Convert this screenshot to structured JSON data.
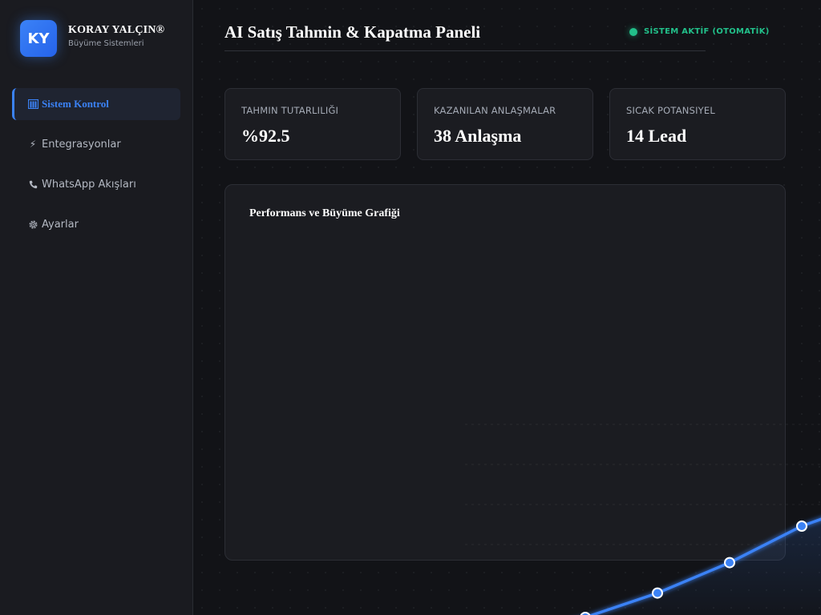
{
  "brand": {
    "logo": "KY",
    "name": "KORAY YALÇIN®",
    "subtitle": "Büyüme Sistemleri"
  },
  "sidebar": {
    "items": [
      {
        "icon": "building-icon",
        "label": "Sistem Kontrol",
        "active": true
      },
      {
        "icon": "lightning-icon",
        "label": "Entegrasyonlar",
        "active": false
      },
      {
        "icon": "phone-icon",
        "label": "WhatsApp Akışları",
        "active": false
      },
      {
        "icon": "gear-icon",
        "label": "Ayarlar",
        "active": false
      }
    ]
  },
  "header": {
    "title": "AI Satış Tahmin & Kapatma Paneli",
    "status": "SİSTEM AKTİF (OTOMATİK)",
    "status_color": "#22c08a"
  },
  "cards": [
    {
      "label": "TAHMIN TUTARLILIĞI",
      "value": "%92.5"
    },
    {
      "label": "KAZANILAN ANLAŞMALAR",
      "value": "38 Anlaşma"
    },
    {
      "label": "SICAK POTANSIYEL",
      "value": "14 Lead"
    }
  ],
  "chart": {
    "title": "Performans ve Büyüme Grafiği"
  },
  "chart_data": {
    "type": "line",
    "title": "Performans ve Büyüme Grafiği",
    "series": [
      {
        "values": [
          0.0,
          0.1,
          0.26,
          0.46,
          0.7,
          0.87,
          1.0
        ]
      }
    ],
    "accent_color": "#3b82f6"
  }
}
